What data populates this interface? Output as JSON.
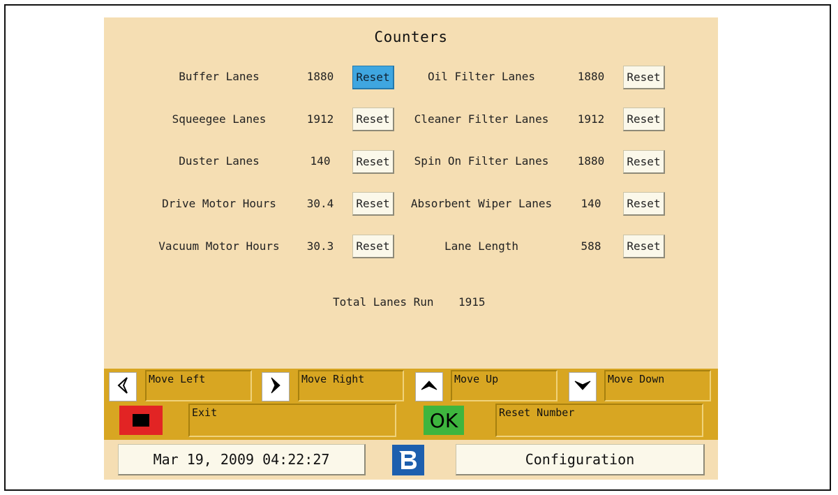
{
  "title": "Counters",
  "left_counters": [
    {
      "label": "Buffer Lanes",
      "value": "1880",
      "reset": "Reset"
    },
    {
      "label": "Squeegee Lanes",
      "value": "1912",
      "reset": "Reset"
    },
    {
      "label": "Duster Lanes",
      "value": "140",
      "reset": "Reset"
    },
    {
      "label": "Drive Motor Hours",
      "value": "30.4",
      "reset": "Reset"
    },
    {
      "label": "Vacuum Motor Hours",
      "value": "30.3",
      "reset": "Reset"
    }
  ],
  "right_counters": [
    {
      "label": "Oil Filter Lanes",
      "value": "1880",
      "reset": "Reset"
    },
    {
      "label": "Cleaner Filter Lanes",
      "value": "1912",
      "reset": "Reset"
    },
    {
      "label": "Spin On Filter Lanes",
      "value": "1880",
      "reset": "Reset"
    },
    {
      "label": "Absorbent Wiper Lanes",
      "value": "140",
      "reset": "Reset"
    },
    {
      "label": "Lane Length",
      "value": "588",
      "reset": "Reset"
    }
  ],
  "total": {
    "label": "Total Lanes Run",
    "value": "1915"
  },
  "nav": {
    "move_left": "Move Left",
    "move_right": "Move Right",
    "move_up": "Move Up",
    "move_down": "Move Down"
  },
  "actions": {
    "exit": "Exit",
    "ok": "OK",
    "reset_number": "Reset Number"
  },
  "status": {
    "datetime": "Mar 19, 2009 04:22:27",
    "configuration": "Configuration"
  },
  "colors": {
    "panel": "#f5deb3",
    "function_bar": "#d8a622",
    "selected_button": "#3fa6e0",
    "exit": "#e22424",
    "ok": "#3eb53e",
    "logo": "#1d5fae"
  }
}
